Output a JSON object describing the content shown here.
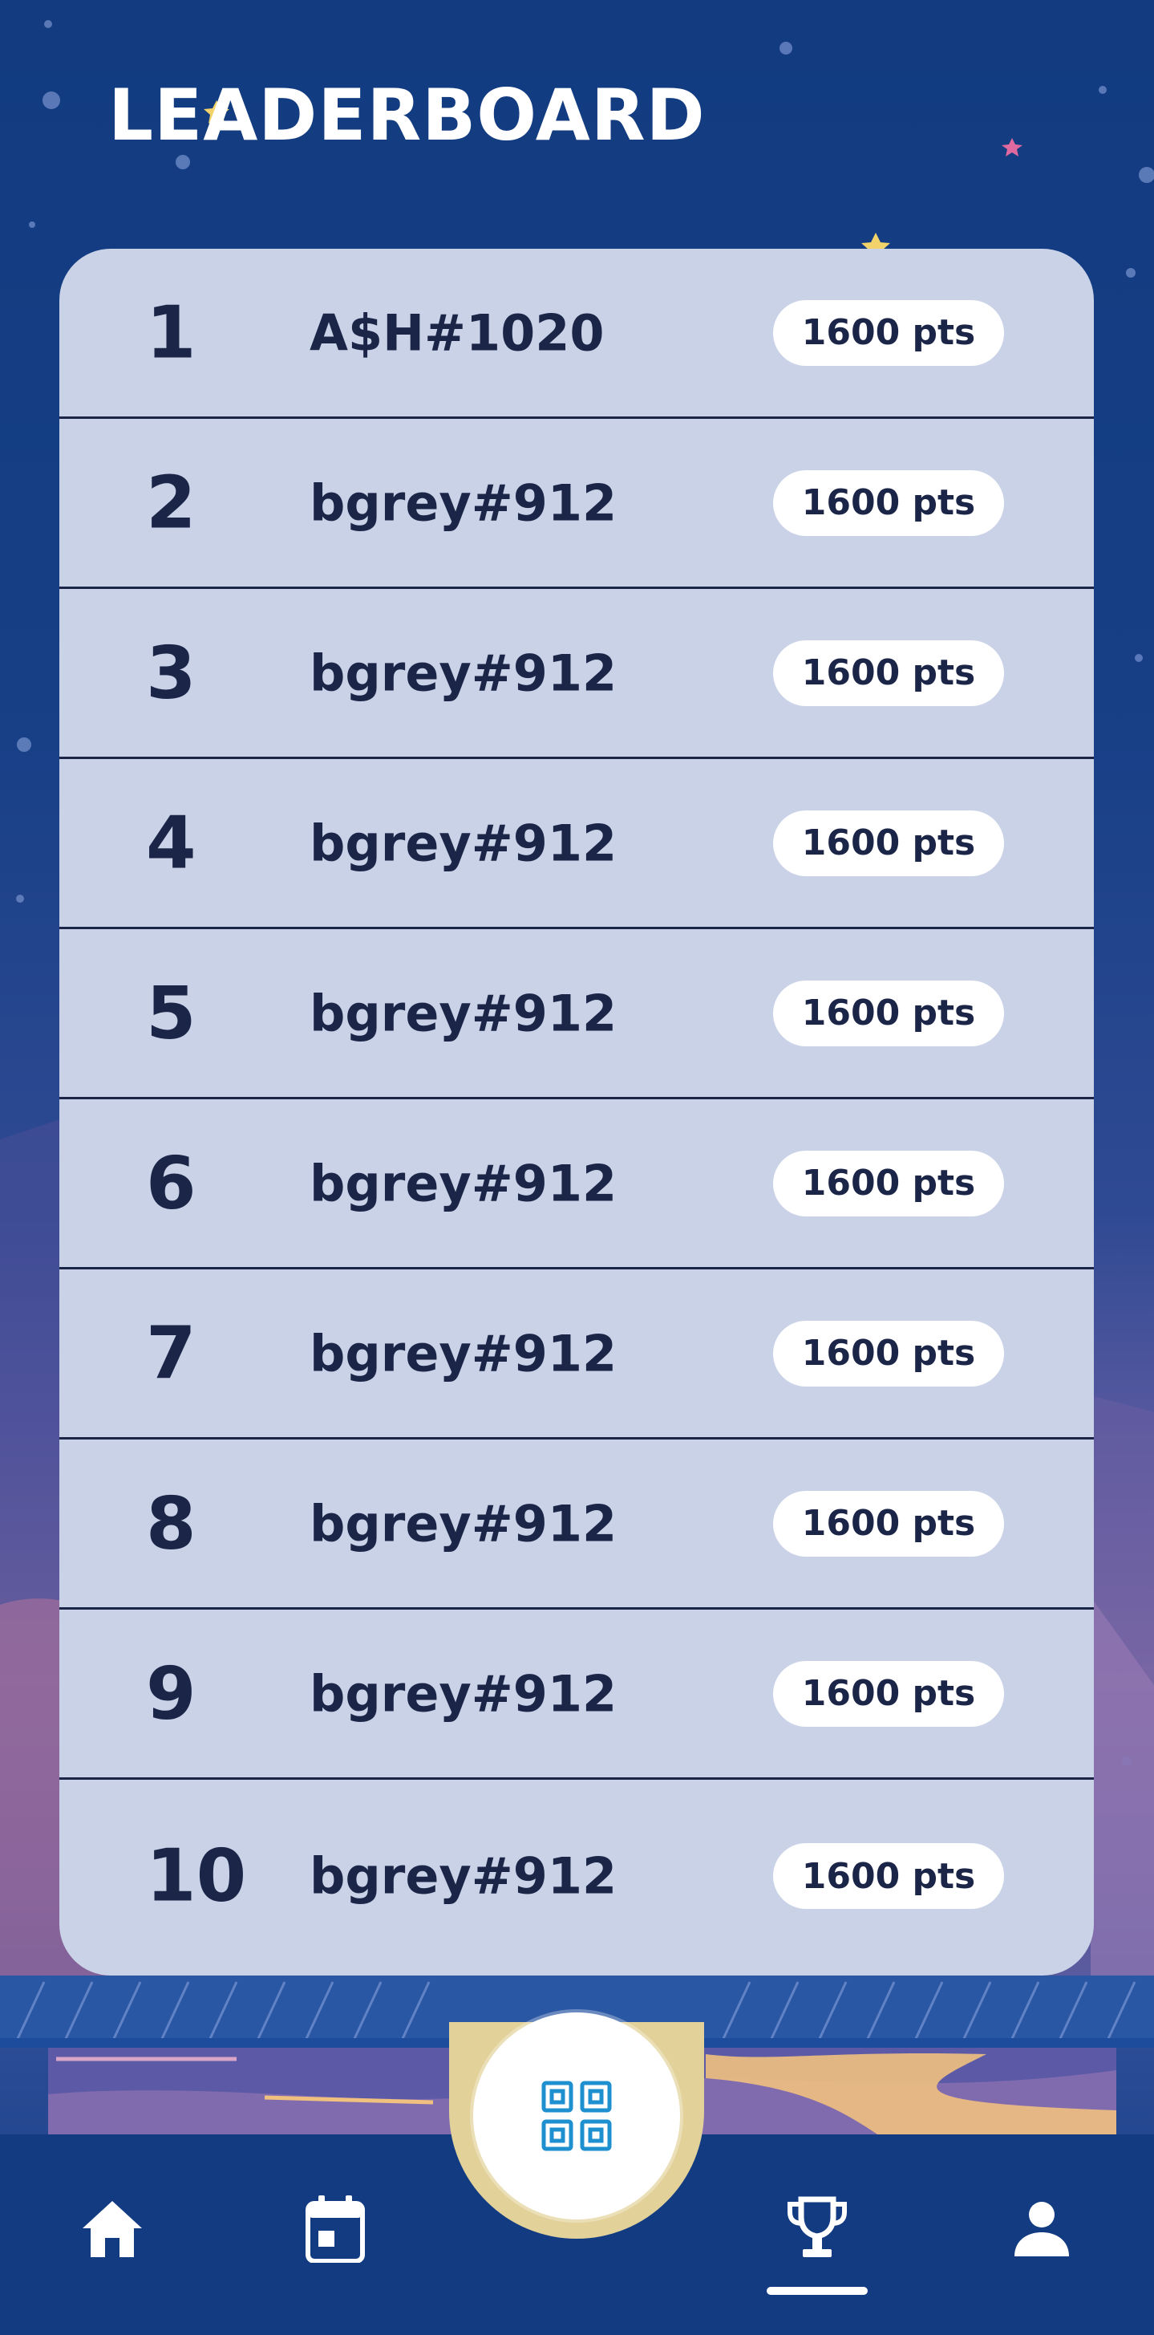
{
  "header": {
    "title": "LEADERBOARD"
  },
  "leaderboard": {
    "rows": [
      {
        "rank": "1",
        "name": "A$H#1020",
        "points": "1600 pts"
      },
      {
        "rank": "2",
        "name": "bgrey#912",
        "points": "1600 pts"
      },
      {
        "rank": "3",
        "name": "bgrey#912",
        "points": "1600 pts"
      },
      {
        "rank": "4",
        "name": "bgrey#912",
        "points": "1600 pts"
      },
      {
        "rank": "5",
        "name": "bgrey#912",
        "points": "1600 pts"
      },
      {
        "rank": "6",
        "name": "bgrey#912",
        "points": "1600 pts"
      },
      {
        "rank": "7",
        "name": "bgrey#912",
        "points": "1600 pts"
      },
      {
        "rank": "8",
        "name": "bgrey#912",
        "points": "1600 pts"
      },
      {
        "rank": "9",
        "name": "bgrey#912",
        "points": "1600 pts"
      },
      {
        "rank": "10",
        "name": "bgrey#912",
        "points": "1600 pts"
      }
    ]
  },
  "nav": {
    "items": [
      "home-icon",
      "calendar-icon",
      "qr-code-icon",
      "trophy-icon",
      "profile-icon"
    ],
    "active": "trophy-icon"
  },
  "colors": {
    "background": "#123b80",
    "card": "#c9d2e6",
    "text": "#1b2548",
    "pill": "#ffffff",
    "qr_accent": "#1e8fcf"
  }
}
